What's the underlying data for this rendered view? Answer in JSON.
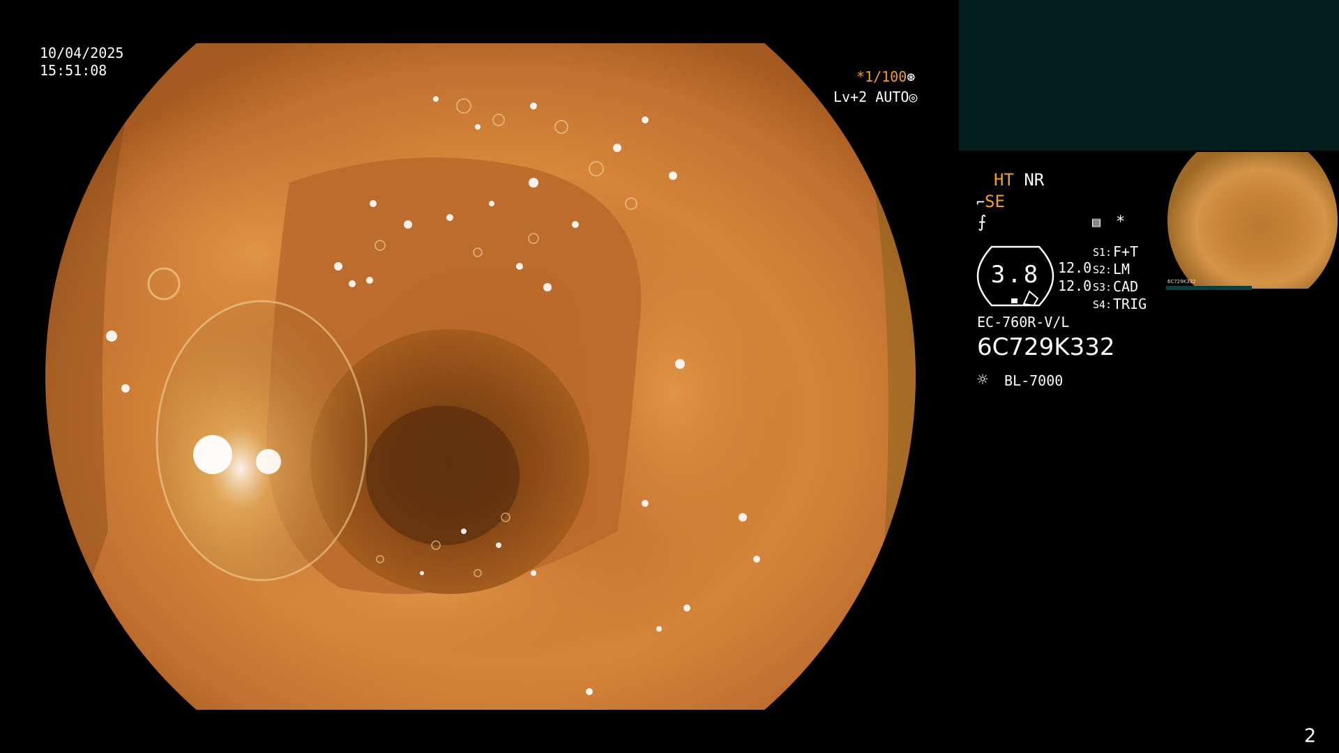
{
  "overlay": {
    "date": "10/04/2025",
    "time": "15:51:08",
    "shutter": "*1/100",
    "shutter_icon": "aperture-icon",
    "level": "Lv+2 AUTO",
    "level_icon": "auto-iris-icon"
  },
  "panel": {
    "ht": "HT",
    "nr": "NR",
    "se": "SE",
    "gauge_value": "3.8",
    "left_values": [
      "12.0",
      "12.0"
    ],
    "switches": [
      {
        "label": "S1:",
        "value": "F+T"
      },
      {
        "label": "S2:",
        "value": "LM"
      },
      {
        "label": "S3:",
        "value": "CAD"
      },
      {
        "label": "S4:",
        "value": "TRIG"
      }
    ],
    "star": "*",
    "model": "EC-760R-V/L",
    "serial": "6C729K332",
    "light_source": "BL-7000"
  },
  "thumbnail": {
    "serial_small": "6C729K332"
  },
  "page_number": "2",
  "colors": {
    "accent_orange": "#f0a21c",
    "teal_box": "#031e1f",
    "mucosa": "#c9762f"
  }
}
